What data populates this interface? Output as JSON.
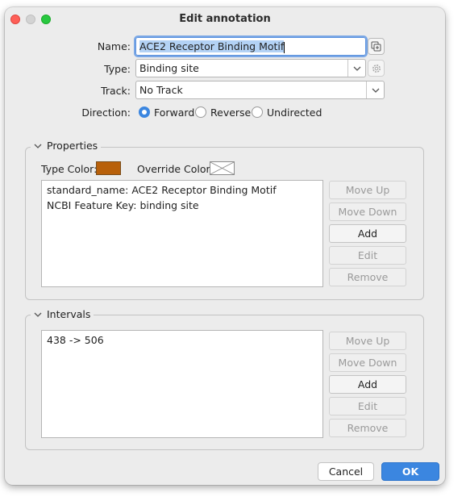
{
  "window": {
    "title": "Edit annotation"
  },
  "form": {
    "name_label": "Name:",
    "name_value": "ACE2 Receptor Binding Motif",
    "type_label": "Type:",
    "type_value": "Binding site",
    "track_label": "Track:",
    "track_value": "No Track",
    "direction_label": "Direction:",
    "direction_options": [
      "Forward",
      "Reverse",
      "Undirected"
    ],
    "direction_selected": "Forward"
  },
  "properties": {
    "title": "Properties",
    "type_color_label": "Type Color:",
    "type_color": "#b8600a",
    "override_color_label": "Override Color:",
    "items": [
      "standard_name: ACE2 Receptor Binding Motif",
      "NCBI Feature Key: binding site"
    ],
    "buttons": [
      "Move Up",
      "Move Down",
      "Add",
      "Edit",
      "Remove"
    ]
  },
  "intervals": {
    "title": "Intervals",
    "items": [
      "438 -> 506"
    ],
    "buttons": [
      "Move Up",
      "Move Down",
      "Add",
      "Edit",
      "Remove"
    ]
  },
  "footer": {
    "cancel_label": "Cancel",
    "ok_label": "OK"
  },
  "colors": {
    "accent": "#3b86e0",
    "window_bg": "#ececec"
  }
}
